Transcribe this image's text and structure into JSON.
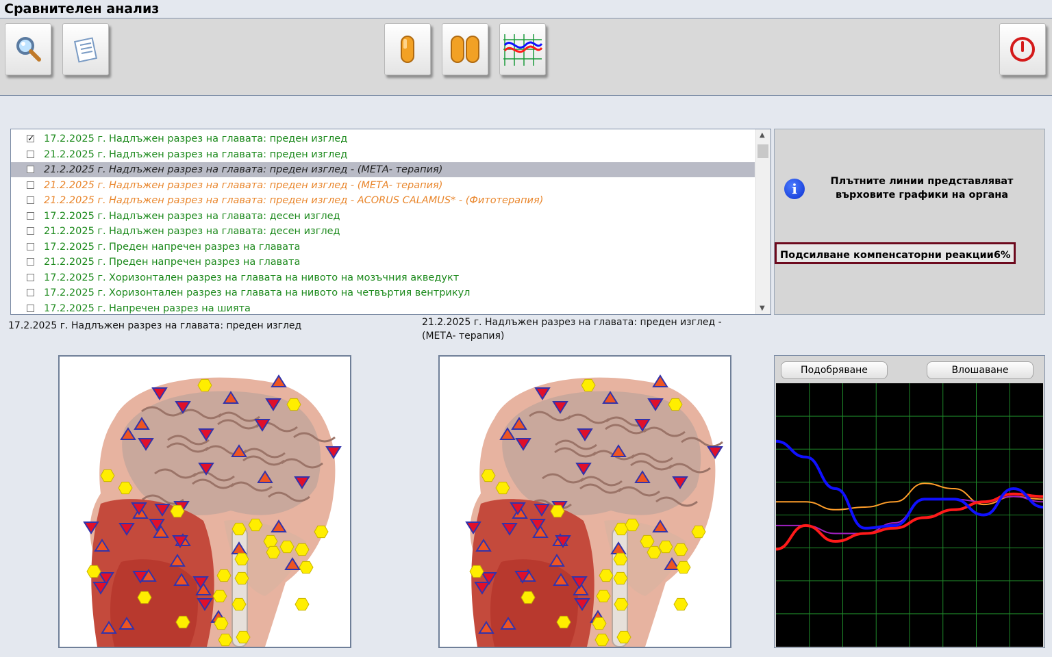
{
  "window": {
    "title": "Сравнителен анализ"
  },
  "toolbar": {
    "buttons": [
      {
        "name": "search-button",
        "icon": "magnifier-icon"
      },
      {
        "name": "report-button",
        "icon": "notepad-icon"
      },
      {
        "name": "single-view-button",
        "icon": "single-capsule-icon"
      },
      {
        "name": "dual-view-button",
        "icon": "dual-capsule-icon"
      },
      {
        "name": "graph-button",
        "icon": "graph-icon"
      },
      {
        "name": "exit-button",
        "icon": "power-icon"
      }
    ]
  },
  "list": {
    "items": [
      {
        "date": "17.2.2025 г.",
        "text": "Надлъжен разрез на главата: преден изглед",
        "style": "green",
        "checked": true
      },
      {
        "date": "21.2.2025 г.",
        "text": "Надлъжен разрез на главата: преден изглед",
        "style": "green",
        "checked": false
      },
      {
        "date": "21.2.2025 г.",
        "text": "Надлъжен разрез на главата: преден изглед - (МЕТА- терапия)",
        "style": "sel",
        "checked": false
      },
      {
        "date": "21.2.2025 г.",
        "text": "Надлъжен разрез на главата: преден изглед - (МЕТА- терапия)",
        "style": "orange",
        "checked": false
      },
      {
        "date": "21.2.2025 г.",
        "text": "Надлъжен разрез на главата: преден изглед - ACORUS  CALAMUS* - (Фитотерапия)",
        "style": "orange",
        "checked": false
      },
      {
        "date": "17.2.2025 г.",
        "text": "Надлъжен разрез на главата: десен изглед",
        "style": "green",
        "checked": false
      },
      {
        "date": "21.2.2025 г.",
        "text": "Надлъжен разрез на главата: десен изглед",
        "style": "green",
        "checked": false
      },
      {
        "date": "17.2.2025 г.",
        "text": "Преден напречен разрез на главата",
        "style": "green",
        "checked": false
      },
      {
        "date": "21.2.2025 г.",
        "text": "Преден напречен разрез на главата",
        "style": "green",
        "checked": false
      },
      {
        "date": "17.2.2025 г.",
        "text": "Хоризонтален разрез на главата на нивото на мозъчния акведукт",
        "style": "green",
        "checked": false
      },
      {
        "date": "17.2.2025 г.",
        "text": "Хоризонтален разрез на главата на нивото на четвъртия вентрикул",
        "style": "green",
        "checked": false
      },
      {
        "date": "17.2.2025 г.",
        "text": "Напречен разрез на шията",
        "style": "green",
        "checked": false
      }
    ]
  },
  "info": {
    "text": "Плътните линии представляват върховите графики на органа",
    "compensation": "Подсилване компенсаторни реакции6%"
  },
  "captions": {
    "left": "17.2.2025 г.  Надлъжен разрез на главата: преден изглед",
    "right": "21.2.2025 г.  Надлъжен разрез на главата: преден изглед - (МЕТА- терапия)"
  },
  "chart": {
    "improve_label": "Подобряване",
    "worsen_label": "Влошаване"
  },
  "chart_data": {
    "type": "line",
    "series": [
      {
        "color": "#1010ff",
        "values": [
          0.78,
          0.72,
          0.6,
          0.45,
          0.46,
          0.56,
          0.56,
          0.5,
          0.6,
          0.53
        ]
      },
      {
        "color": "#ff1a1a",
        "values": [
          0.37,
          0.46,
          0.4,
          0.43,
          0.45,
          0.49,
          0.52,
          0.55,
          0.58,
          0.57
        ]
      },
      {
        "color": "#a020c0",
        "values": [
          0.46,
          0.46,
          0.43,
          0.43,
          0.47,
          0.56,
          0.56,
          0.55,
          0.57,
          0.55
        ]
      },
      {
        "color": "#ff9e2a",
        "values": [
          0.55,
          0.55,
          0.52,
          0.53,
          0.55,
          0.62,
          0.6,
          0.54,
          0.57,
          0.56
        ]
      }
    ],
    "grid": true
  },
  "colors": {
    "marker_triangle": "#ee5522",
    "marker_inverted": "#e0102a",
    "marker_hexagon": "#ffee00",
    "marker_border": "#3333aa"
  }
}
